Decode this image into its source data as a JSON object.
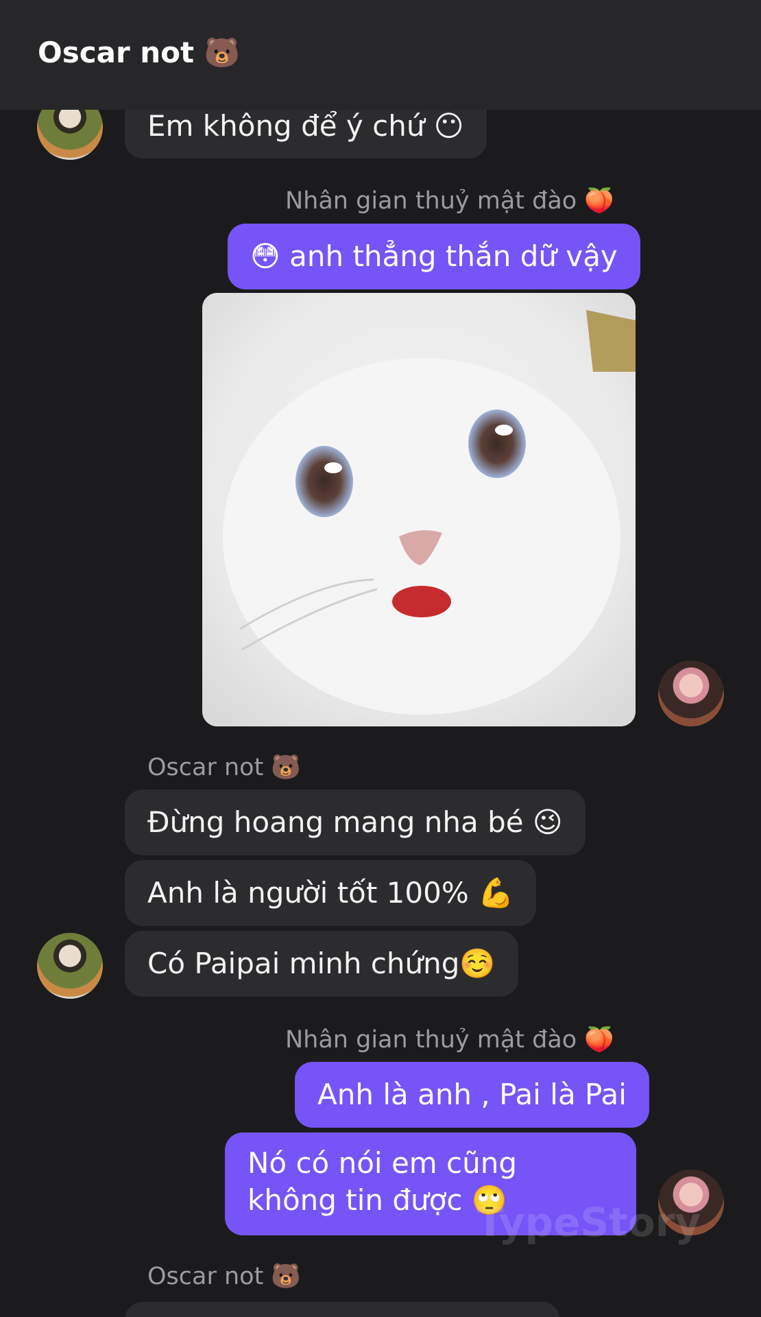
{
  "header": {
    "title": "Oscar not 🐻"
  },
  "messages": {
    "m1": "Em không để ý chứ 😶",
    "m2_sender": "Nhân gian thuỷ mật đào 🍑",
    "m2": "😳 anh thẳng thắn dữ vậy",
    "m3_sender": "Oscar not 🐻",
    "m3": "Đừng hoang mang nha bé 😉",
    "m4": "Anh là người tốt 100% 💪",
    "m5": "Có Paipai minh chứng☺️",
    "m6_sender": "Nhân gian thuỷ mật đào 🍑",
    "m6": "Anh là anh , Pai là Pai",
    "m7": "Nó có nói em cũng không tin được 🙄",
    "m8_sender": "Oscar not 🐻"
  },
  "watermark": "TypeStory",
  "colors": {
    "background": "#1b1b1d",
    "header": "#27272a",
    "incoming_bubble": "#2c2c2f",
    "outgoing_bubble": "#7654f7",
    "sender_text": "#9b9ba0"
  },
  "icons": {
    "contact_avatar": "avatar",
    "user_avatar": "avatar",
    "sticker": "white-cat-photo"
  }
}
